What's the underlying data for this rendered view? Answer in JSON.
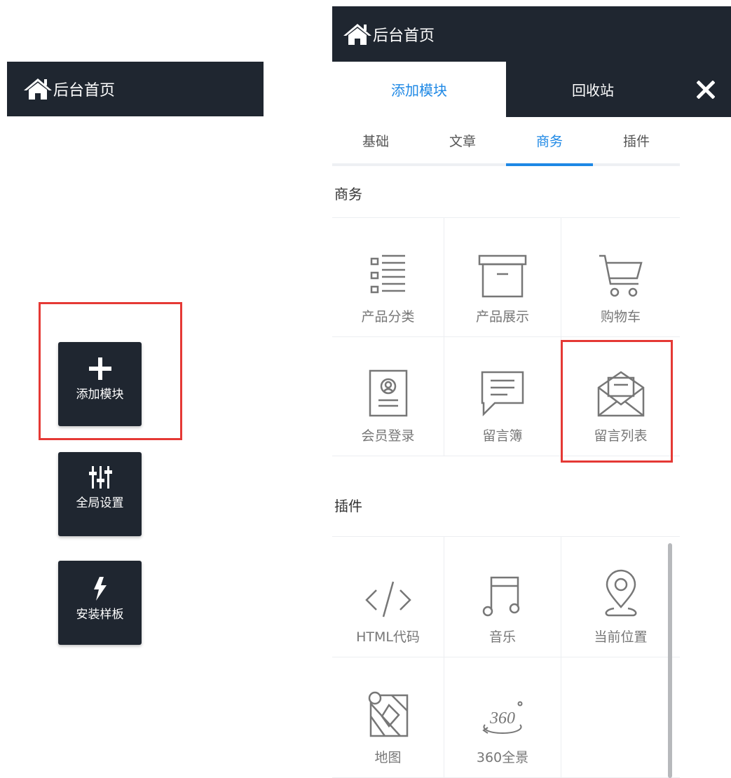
{
  "left": {
    "topbar": {
      "title": "后台首页",
      "icon": "home-icon"
    },
    "tools": [
      {
        "label": "添加模块",
        "icon": "plus-icon"
      },
      {
        "label": "全局设置",
        "icon": "sliders-icon"
      },
      {
        "label": "安装样板",
        "icon": "lightning-icon"
      }
    ]
  },
  "right": {
    "topbar": {
      "title": "后台首页",
      "icon": "home-icon"
    },
    "head_tabs": [
      {
        "label": "添加模块",
        "active": true
      },
      {
        "label": "回收站",
        "active": false
      }
    ],
    "close_icon": "close-icon",
    "sub_tabs": [
      {
        "label": "基础",
        "active": false
      },
      {
        "label": "文章",
        "active": false
      },
      {
        "label": "商务",
        "active": true
      },
      {
        "label": "插件",
        "active": false
      }
    ],
    "sections": [
      {
        "title": "商务",
        "items": [
          {
            "label": "产品分类",
            "icon": "list-icon"
          },
          {
            "label": "产品展示",
            "icon": "box-icon"
          },
          {
            "label": "购物车",
            "icon": "cart-icon"
          },
          {
            "label": "会员登录",
            "icon": "member-card-icon"
          },
          {
            "label": "留言簿",
            "icon": "message-icon"
          },
          {
            "label": "留言列表",
            "icon": "envelope-icon"
          }
        ]
      },
      {
        "title": "插件",
        "items": [
          {
            "label": "HTML代码",
            "icon": "code-icon"
          },
          {
            "label": "音乐",
            "icon": "music-icon"
          },
          {
            "label": "当前位置",
            "icon": "location-pin-icon"
          },
          {
            "label": "地图",
            "icon": "map-icon"
          },
          {
            "label": "360全景",
            "icon": "panorama-360-icon"
          }
        ]
      }
    ]
  },
  "colors": {
    "dark": "#1f2630",
    "accent": "#1e88e5",
    "highlight": "#e53935"
  }
}
